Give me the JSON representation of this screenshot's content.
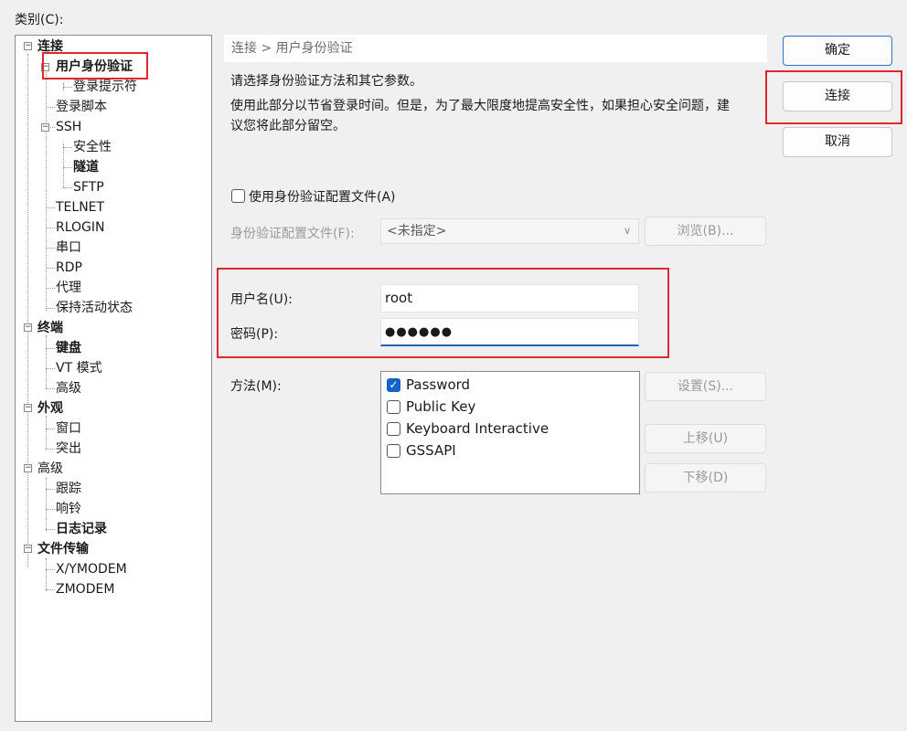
{
  "category_label": "类别(C):",
  "tree": [
    {
      "label": "连接",
      "bold": true
    },
    {
      "label": "用户身份验证",
      "bold": true
    },
    {
      "label": "登录提示符"
    },
    {
      "label": "登录脚本"
    },
    {
      "label": "SSH"
    },
    {
      "label": "安全性"
    },
    {
      "label": "隧道",
      "bold": true
    },
    {
      "label": "SFTP"
    },
    {
      "label": "TELNET"
    },
    {
      "label": "RLOGIN"
    },
    {
      "label": "串口"
    },
    {
      "label": "RDP"
    },
    {
      "label": "代理"
    },
    {
      "label": "保持活动状态"
    },
    {
      "label": "终端",
      "bold": true
    },
    {
      "label": "键盘",
      "bold": true
    },
    {
      "label": "VT 模式"
    },
    {
      "label": "高级"
    },
    {
      "label": "外观",
      "bold": true
    },
    {
      "label": "窗口"
    },
    {
      "label": "突出"
    },
    {
      "label": "高级"
    },
    {
      "label": "跟踪"
    },
    {
      "label": "响铃"
    },
    {
      "label": "日志记录",
      "bold": true
    },
    {
      "label": "文件传输",
      "bold": true
    },
    {
      "label": "X/YMODEM"
    },
    {
      "label": "ZMODEM"
    }
  ],
  "breadcrumb": "连接 > 用户身份验证",
  "intro": "请选择身份验证方法和其它参数。",
  "desc_line1": "使用此部分以节省登录时间。但是，为了最大限度地提高安全性，如果担心安全问题，建",
  "desc_line2": "议您将此部分留空。",
  "use_profile_label": "使用身份验证配置文件(A)",
  "use_profile_checked": false,
  "profile_label": "身份验证配置文件(F):",
  "profile_value": "<未指定>",
  "browse_button": "浏览(B)...",
  "username_label": "用户名(U):",
  "username_value": "root",
  "password_label": "密码(P):",
  "password_value": "●●●●●●",
  "method_label": "方法(M):",
  "methods": [
    {
      "label": "Password",
      "checked": true
    },
    {
      "label": "Public Key",
      "checked": false
    },
    {
      "label": "Keyboard Interactive",
      "checked": false
    },
    {
      "label": "GSSAPI",
      "checked": false
    }
  ],
  "settings_button": "设置(S)...",
  "move_up_button": "上移(U)",
  "move_down_button": "下移(D)",
  "ok_button": "确定",
  "connect_button": "连接",
  "cancel_button": "取消",
  "highlight_color": "#e0262f",
  "accent_color": "#1464c8"
}
